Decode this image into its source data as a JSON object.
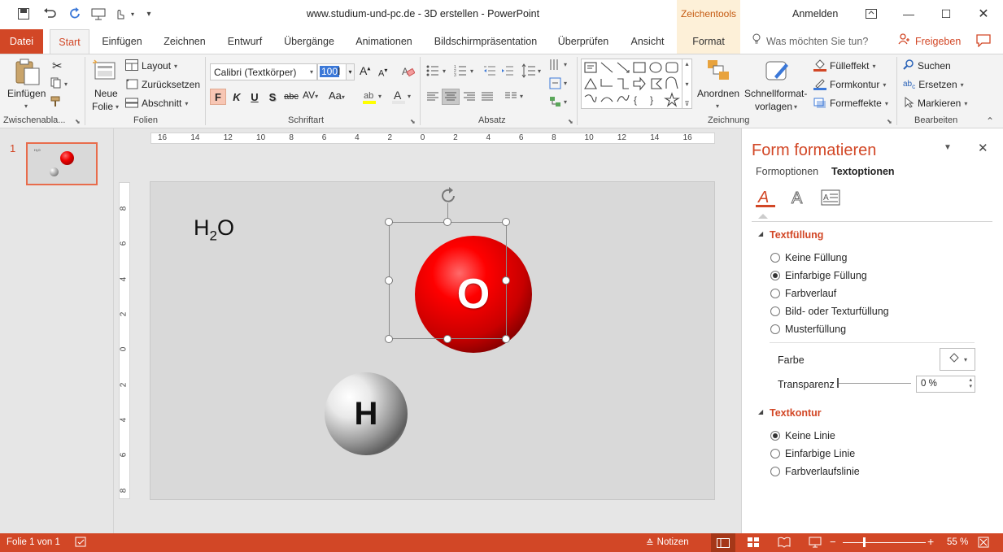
{
  "window": {
    "title": "www.studium-und-pc.de - 3D erstellen  -  PowerPoint",
    "contextual_label": "Zeichentools",
    "signin": "Anmelden"
  },
  "tabs": [
    "Datei",
    "Start",
    "Einfügen",
    "Zeichnen",
    "Entwurf",
    "Übergänge",
    "Animationen",
    "Bildschirmpräsentation",
    "Überprüfen",
    "Ansicht",
    "Format"
  ],
  "search_placeholder": "Was möchten Sie tun?",
  "share": "Freigeben",
  "ribbon": {
    "clipboard": {
      "paste": "Einfügen",
      "label": "Zwischenabla..."
    },
    "slides": {
      "new_slide_1": "Neue",
      "new_slide_2": "Folie",
      "layout": "Layout",
      "reset": "Zurücksetzen",
      "section": "Abschnitt",
      "label": "Folien"
    },
    "font": {
      "name": "Calibri (Textkörper)",
      "size": "100",
      "bold": "F",
      "italic": "K",
      "underline": "U",
      "shadow": "S",
      "strike": "abc",
      "label": "Schriftart"
    },
    "paragraph": {
      "label": "Absatz"
    },
    "drawing": {
      "arrange": "Anordnen",
      "quick_styles_1": "Schnellformat-",
      "quick_styles_2": "vorlagen",
      "fill": "Fülleffekt",
      "outline": "Formkontur",
      "effects": "Formeffekte",
      "label": "Zeichnung"
    },
    "editing": {
      "find": "Suchen",
      "replace": "Ersetzen",
      "select": "Markieren",
      "label": "Bearbeiten"
    }
  },
  "ruler": {
    "h_ticks": [
      "16",
      "14",
      "12",
      "10",
      "8",
      "6",
      "4",
      "2",
      "0",
      "2",
      "4",
      "6",
      "8",
      "10",
      "12",
      "14",
      "16"
    ],
    "v_ticks": [
      "8",
      "6",
      "4",
      "2",
      "0",
      "2",
      "4",
      "6",
      "8"
    ]
  },
  "slide_panel": {
    "number": "1"
  },
  "slide": {
    "formula_main": "H",
    "formula_sub": "2",
    "formula_end": "O",
    "sphere_o_label": "O",
    "sphere_h_label": "H"
  },
  "pane": {
    "title": "Form formatieren",
    "tab_shape": "Formoptionen",
    "tab_text": "Textoptionen",
    "fill_header": "Textfüllung",
    "fill_options": [
      "Keine Füllung",
      "Einfarbige Füllung",
      "Farbverlauf",
      "Bild- oder Texturfüllung",
      "Musterfüllung"
    ],
    "fill_selected": 1,
    "color_label": "Farbe",
    "transparency_label": "Transparenz",
    "transparency_value": "0 %",
    "outline_header": "Textkontur",
    "outline_options": [
      "Keine Linie",
      "Einfarbige Linie",
      "Farbverlaufslinie"
    ],
    "outline_selected": 0
  },
  "status": {
    "slide": "Folie 1 von 1",
    "notes": "Notizen",
    "zoom": "55 %"
  },
  "colors": {
    "accent": "#d24726",
    "selection": "#3b78d8"
  }
}
